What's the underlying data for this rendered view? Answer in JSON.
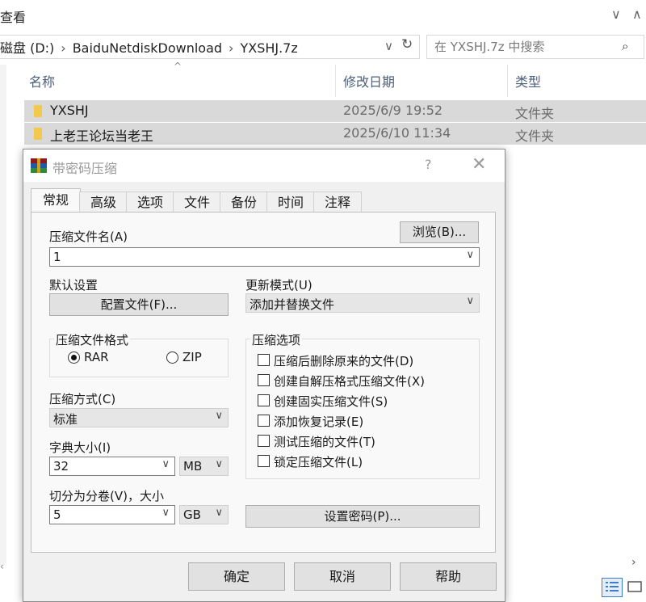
{
  "explorer": {
    "view_label": "查看",
    "address": [
      "磁盘 (D:)",
      "BaiduNetdiskDownload",
      "YXSHJ.7z"
    ],
    "search_placeholder": "在 YXSHJ.7z 中搜索",
    "columns": {
      "name": "名称",
      "date": "修改日期",
      "type": "类型"
    },
    "files": [
      {
        "name": "YXSHJ",
        "date": "2025/6/9 19:52",
        "type": "文件夹"
      },
      {
        "name": "上老王论坛当老王",
        "date": "2025/6/10 11:34",
        "type": "文件夹"
      }
    ]
  },
  "dialog": {
    "title": "带密码压缩",
    "help": "?",
    "close": "✕",
    "tabs": [
      "常规",
      "高级",
      "选项",
      "文件",
      "备份",
      "时间",
      "注释"
    ],
    "active_tab": "常规",
    "archive_name_label": "压缩文件名(A)",
    "archive_name_value": "1",
    "browse_label": "浏览(B)...",
    "default_settings_label": "默认设置",
    "profiles_label": "配置文件(F)...",
    "update_mode_label": "更新模式(U)",
    "update_mode_value": "添加并替换文件",
    "format_group_label": "压缩文件格式",
    "format_rar": "RAR",
    "format_zip": "ZIP",
    "format_selected": "RAR",
    "method_label": "压缩方式(C)",
    "method_value": "标准",
    "dict_label": "字典大小(I)",
    "dict_value": "32",
    "dict_unit": "MB",
    "split_label": "切分为分卷(V)，大小",
    "split_value": "5",
    "split_unit": "GB",
    "options_group_label": "压缩选项",
    "options": [
      "压缩后删除原来的文件(D)",
      "创建自解压格式压缩文件(X)",
      "创建固实压缩文件(S)",
      "添加恢复记录(E)",
      "测试压缩的文件(T)",
      "锁定压缩文件(L)"
    ],
    "set_password_label": "设置密码(P)...",
    "ok_label": "确定",
    "cancel_label": "取消",
    "help_label": "帮助"
  },
  "colors": {
    "selection": "#d9d9d9",
    "folder": "#f2c94c",
    "dialog_bg": "#f0f0f0"
  }
}
